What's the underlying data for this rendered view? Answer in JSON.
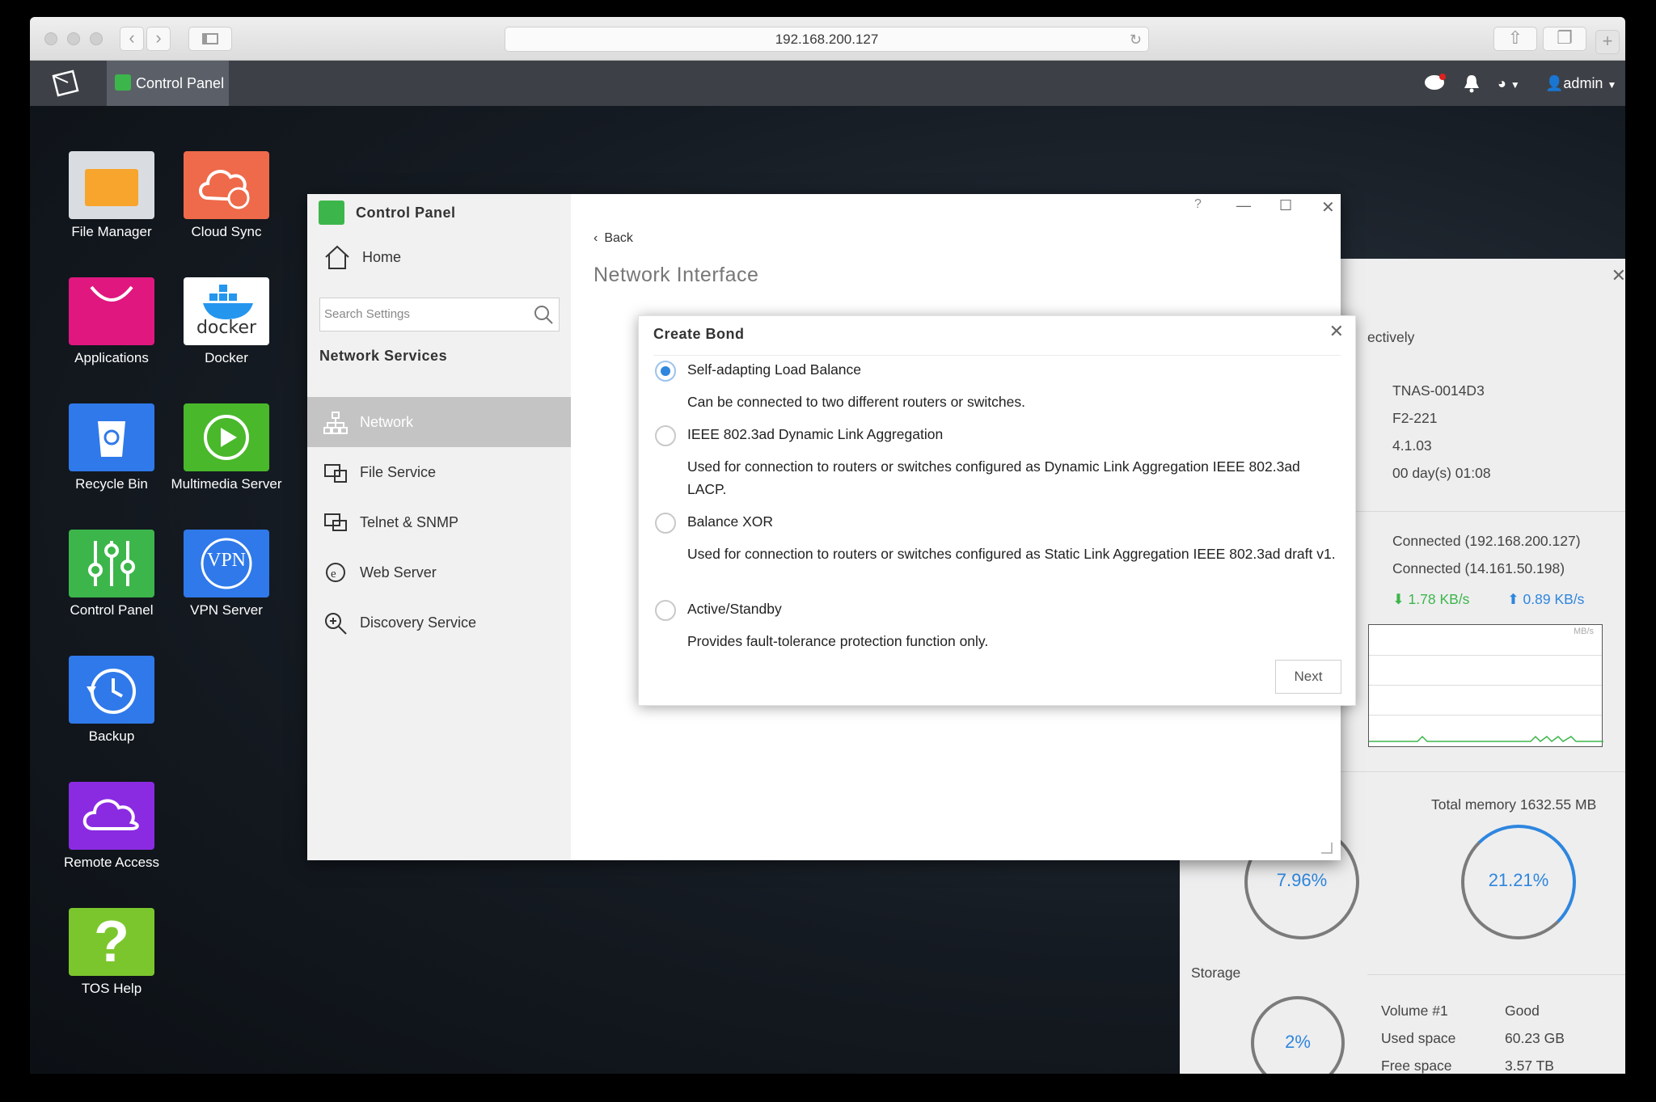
{
  "browser": {
    "url": "192.168.200.127"
  },
  "nasbar": {
    "tab": "Control Panel",
    "user": "admin"
  },
  "desktop": {
    "icons": [
      {
        "label": "File Manager"
      },
      {
        "label": "Cloud Sync"
      },
      {
        "label": "Applications"
      },
      {
        "label": "Docker"
      },
      {
        "label": "Recycle Bin"
      },
      {
        "label": "Multimedia Server"
      },
      {
        "label": "Control Panel"
      },
      {
        "label": "VPN Server"
      },
      {
        "label": "Backup"
      },
      {
        "label": "Remote Access"
      },
      {
        "label": "TOS Help"
      }
    ],
    "docker_text": "docker",
    "vpn_text": "VPN"
  },
  "control_panel": {
    "title": "Control Panel",
    "home": "Home",
    "search_placeholder": "Search Settings",
    "section": "Network Services",
    "items": [
      {
        "label": "Network"
      },
      {
        "label": "File Service"
      },
      {
        "label": "Telnet & SNMP"
      },
      {
        "label": "Web Server"
      },
      {
        "label": "Discovery Service"
      }
    ],
    "back": "Back",
    "page_title": "Network Interface",
    "help": "?"
  },
  "dialog": {
    "title": "Create Bond",
    "options": [
      {
        "label": "Self-adapting Load Balance",
        "desc": "Can be connected to two different routers or switches.",
        "selected": true
      },
      {
        "label": "IEEE 802.3ad Dynamic Link Aggregation",
        "desc": "Used for connection to routers or switches configured as Dynamic Link Aggregation IEEE 802.3ad LACP.",
        "selected": false
      },
      {
        "label": "Balance XOR",
        "desc": "Used for connection to routers or switches configured as Static Link Aggregation IEEE 802.3ad draft v1.",
        "selected": false
      },
      {
        "label": "Active/Standby",
        "desc": "Provides fault-tolerance protection function only.",
        "selected": false
      }
    ],
    "next": "Next"
  },
  "info_panel": {
    "partial_text": "ectively",
    "device": [
      "TNAS-0014D3",
      "F2-221",
      "4.1.03",
      "00 day(s) 01:08"
    ],
    "connections": [
      "Connected (192.168.200.127)",
      "Connected (14.161.50.198)"
    ],
    "download": "1.78 KB/s",
    "upload": "0.89 KB/s",
    "graph_unit": "MB/s",
    "total_memory": "Total memory 1632.55 MB",
    "cpu_percent": "7.96%",
    "memory_percent": "21.21%",
    "storage_label": "Storage",
    "storage_percent": "2%",
    "volume": {
      "name_label": "Volume #1",
      "status": "Good",
      "used_label": "Used space",
      "used": "60.23 GB",
      "free_label": "Free space",
      "free": "3.57 TB"
    }
  },
  "colors": {
    "accent": "#2e86de",
    "green": "#3cb64a",
    "panel_bg": "#f1f1f1"
  }
}
